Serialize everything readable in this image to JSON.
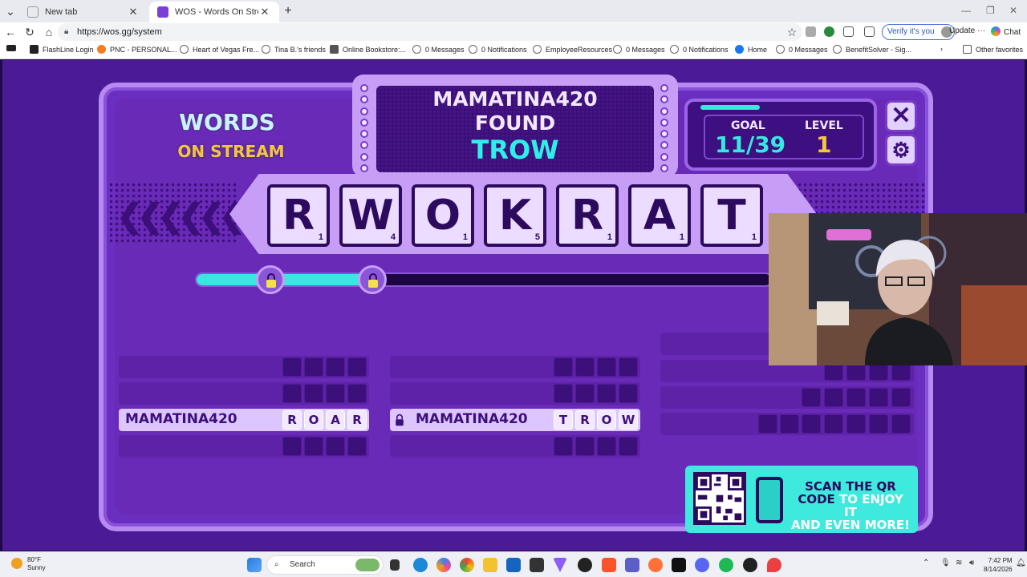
{
  "browser": {
    "tabs": [
      {
        "title": "New tab",
        "active": false
      },
      {
        "title": "WOS - Words On Stream",
        "active": true
      }
    ],
    "new_tab_label": "+",
    "url": "https://wos.gg/system",
    "verify_label": "Verify it's you",
    "update_label": "Update",
    "chat_label": "Chat",
    "bookmarks": [
      {
        "label": "FlashLine Login",
        "icon": "flashline-icon"
      },
      {
        "label": "PNC - PERSONAL...",
        "icon": "pnc-icon"
      },
      {
        "label": "Heart of Vegas Fre...",
        "icon": "globe-icon"
      },
      {
        "label": "Tina B.'s friends",
        "icon": "globe-icon"
      },
      {
        "label": "Online Bookstore:...",
        "icon": "bookstore-icon"
      },
      {
        "label": "0 Messages",
        "icon": "globe-icon"
      },
      {
        "label": "0 Notifications",
        "icon": "globe-icon"
      },
      {
        "label": "EmployeeResources",
        "icon": "globe-icon"
      },
      {
        "label": "0 Messages",
        "icon": "globe-icon"
      },
      {
        "label": "0 Notifications",
        "icon": "globe-icon"
      },
      {
        "label": "Home",
        "icon": "facebook-icon"
      },
      {
        "label": "0 Messages",
        "icon": "globe-icon"
      },
      {
        "label": "BenefitSolver - Sig...",
        "icon": "globe-icon"
      }
    ],
    "other_favorites": "Other favorites"
  },
  "game": {
    "logo": {
      "line1": "WORDS",
      "line2": "ON STREAM"
    },
    "found": {
      "player": "MAMATINA420",
      "label": "FOUND",
      "word": "TROW"
    },
    "goal_label": "GOAL",
    "goal_value": "11/39",
    "level_label": "LEVEL",
    "level_value": "1",
    "close_icon": "close-icon",
    "settings_icon": "gear-icon",
    "tiles": [
      {
        "letter": "R",
        "points": "1"
      },
      {
        "letter": "W",
        "points": "4"
      },
      {
        "letter": "O",
        "points": "1"
      },
      {
        "letter": "K",
        "points": "5"
      },
      {
        "letter": "R",
        "points": "1"
      },
      {
        "letter": "A",
        "points": "1"
      },
      {
        "letter": "T",
        "points": "1"
      }
    ],
    "progress": 0.32,
    "word_slots": {
      "col1": [
        {
          "name": "",
          "letters": [
            "",
            "",
            "",
            ""
          ]
        },
        {
          "name": "",
          "letters": [
            "",
            "",
            "",
            ""
          ]
        },
        {
          "name": "MAMATINA420",
          "letters": [
            "R",
            "O",
            "A",
            "R"
          ]
        },
        {
          "name": "",
          "letters": [
            "",
            "",
            "",
            ""
          ]
        }
      ],
      "col2": [
        {
          "name": "",
          "letters": [
            "",
            "",
            "",
            ""
          ]
        },
        {
          "name": "",
          "letters": [
            "",
            "",
            "",
            ""
          ]
        },
        {
          "name": "MAMATINA420",
          "letters": [
            "T",
            "R",
            "O",
            "W"
          ]
        },
        {
          "name": "",
          "letters": [
            "",
            "",
            "",
            ""
          ]
        }
      ]
    },
    "qr_text": {
      "part1": "SCAN THE QR",
      "part2": "CODE",
      "part3": "TO ENJOY IT",
      "part4": "AND EVEN MORE!"
    },
    "colors": {
      "accent": "#37e7e0",
      "gold": "#f5c542",
      "panel": "#6a2fc0"
    }
  },
  "taskbar": {
    "weather_temp": "80°F",
    "weather_desc": "Sunny",
    "search_placeholder": "Search",
    "time": "7:42 PM",
    "date": "8/14/2026"
  }
}
